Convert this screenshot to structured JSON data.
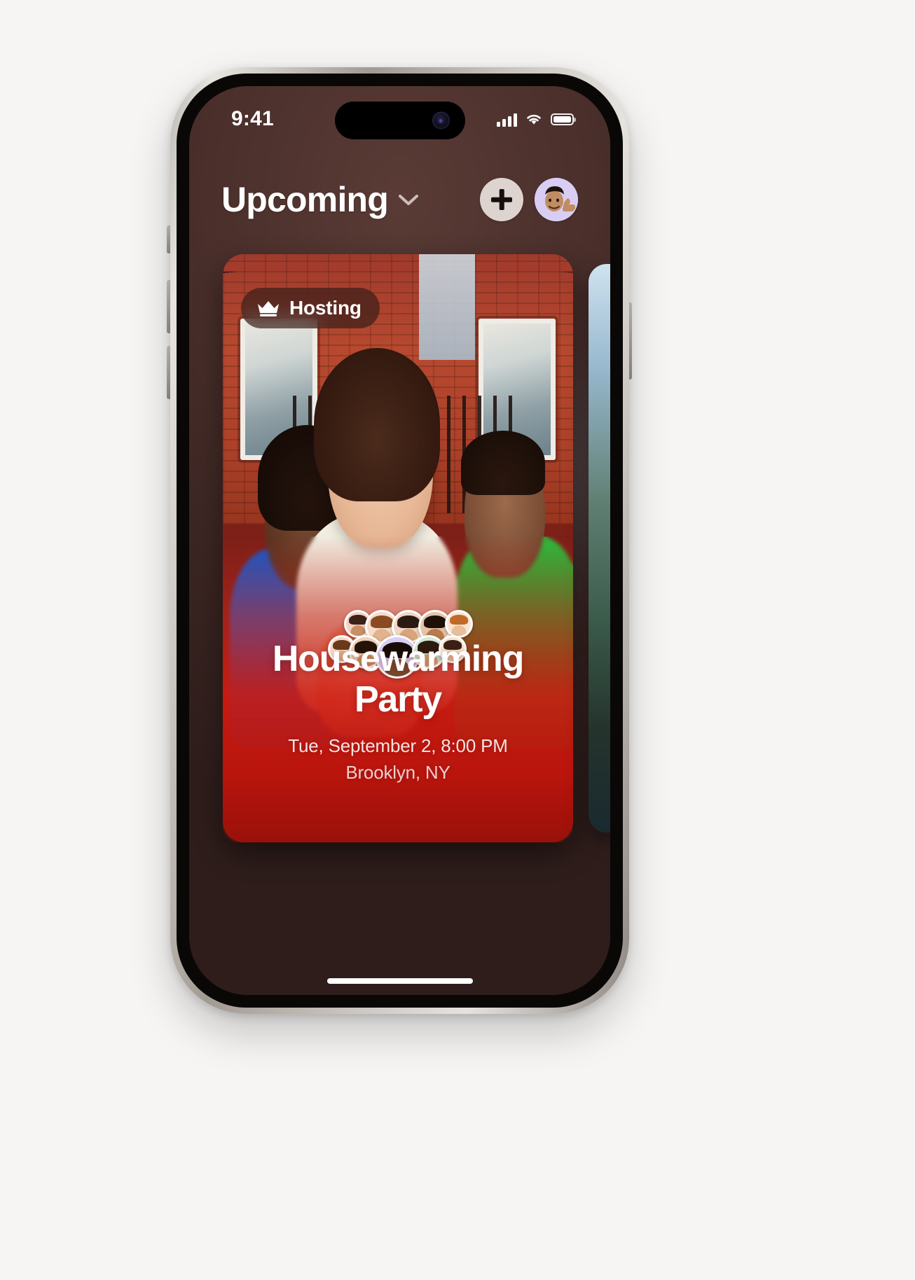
{
  "device": {
    "status_bar": {
      "time": "9:41",
      "cellular_icon": "cellular-signal-icon",
      "wifi_icon": "wifi-icon",
      "battery_icon": "battery-icon"
    },
    "home_indicator": "home-indicator"
  },
  "navbar": {
    "title": "Upcoming",
    "title_chevron_icon": "chevron-down-icon",
    "add_button_icon": "plus-icon",
    "profile_avatar": "memoji-avatar"
  },
  "event_card": {
    "badge": {
      "icon": "crown-icon",
      "label": "Hosting"
    },
    "title": "Housewarming Party",
    "title_line_1": "Housewarming",
    "title_line_2": "Party",
    "date": "Tue, September 2, 8:00 PM",
    "location": "Brooklyn, NY",
    "guests": [
      {
        "id": "guest-1",
        "skin": "#c98f62",
        "hair": "#3b2216"
      },
      {
        "id": "guest-2",
        "skin": "#e2b38c",
        "hair": "#8a4b22"
      },
      {
        "id": "guest-3",
        "skin": "#d9a479",
        "hair": "#2b1a12"
      },
      {
        "id": "guest-4",
        "skin": "#b97b4e",
        "hair": "#1d1009"
      },
      {
        "id": "guest-5",
        "skin": "#e8bf9a",
        "hair": "#c06a2a"
      },
      {
        "id": "guest-6",
        "skin": "#e4b488",
        "hair": "#6b3a1c"
      },
      {
        "id": "guest-7",
        "skin": "#cf9463",
        "hair": "#241309"
      },
      {
        "id": "guest-8",
        "skin": "#7a4a2c",
        "hair": "#160c06"
      },
      {
        "id": "guest-9",
        "skin": "#d6a172",
        "hair": "#2e1a10"
      },
      {
        "id": "guest-10",
        "skin": "#e9c2a0",
        "hair": "#3a2014"
      }
    ]
  },
  "colors": {
    "app_background": "#3a2522",
    "card_accent_red": "#d61c12",
    "badge_background": "rgba(44,26,22,0.62)",
    "button_background": "#ddd4cf",
    "avatar_background": "#d9cdf4",
    "text_primary": "#ffffff"
  }
}
